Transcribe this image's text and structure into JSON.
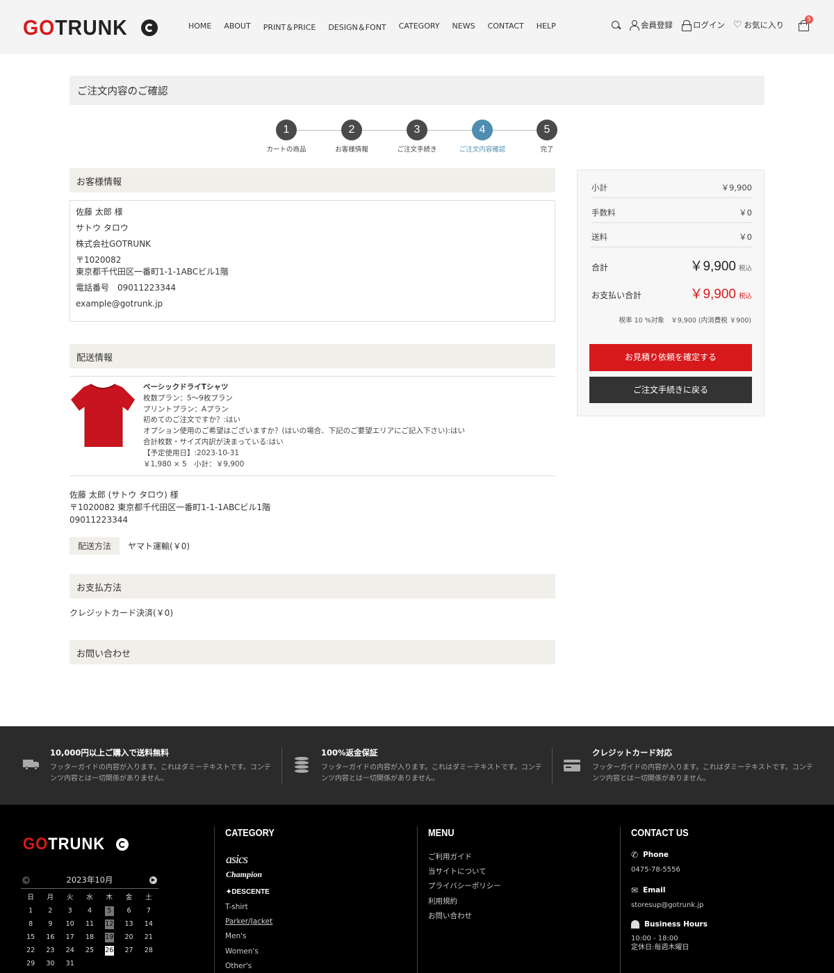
{
  "header": {
    "logo_go": "GO",
    "logo_trunk": "TRUNK",
    "nav": [
      "HOME",
      "ABOUT",
      "PRINT＆PRICE",
      "DESIGN＆FONT",
      "CATEGORY",
      "NEWS",
      "CONTACT",
      "HELP"
    ],
    "register": "会員登録",
    "login": "ログイン",
    "favorites": "お気に入り",
    "cart_count": "5"
  },
  "page": {
    "title": "ご注文内容のご確認"
  },
  "steps": [
    {
      "num": "1",
      "label": "カートの商品"
    },
    {
      "num": "2",
      "label": "お客様情報"
    },
    {
      "num": "3",
      "label": "ご注文手続き"
    },
    {
      "num": "4",
      "label": "ご注文内容確認"
    },
    {
      "num": "5",
      "label": "完了"
    }
  ],
  "customer": {
    "heading": "お客様情報",
    "name": "佐藤 太郎 様",
    "kana": "サトウ タロウ",
    "company": "株式会社GOTRUNK",
    "zip": "〒1020082",
    "address": "東京都千代田区一番町1-1-1ABCビル1階",
    "phone": "電話番号　09011223344",
    "email": "example@gotrunk.jp"
  },
  "shipping": {
    "heading": "配送情報",
    "product_name": "ベーシックドライTシャツ",
    "product_lines": [
      "枚数プラン：5〜9枚プラン",
      "プリントプラン：Aプラン",
      "初めてのご注文ですか？:はい",
      "オプション使用のご希望はございますか？(はいの場合、下記のご要望エリアにご記入下さい):はい",
      "合計枚数・サイズ内訳が決まっている:はい",
      "【予定使用日】:2023-10-31",
      "￥1,980 × 5　小計：￥9,900"
    ],
    "recipient": "佐藤 太郎 (サトウ タロウ) 様",
    "recipient_address": "〒1020082 東京都千代田区一番町1-1-1ABCビル1階",
    "recipient_phone": "09011223344",
    "method_label": "配送方法",
    "method_value": "ヤマト運輸(￥0)"
  },
  "payment": {
    "heading": "お支払方法",
    "value": "クレジットカード決済(￥0)"
  },
  "inquiry": {
    "heading": "お問い合わせ"
  },
  "summary": {
    "subtotal_label": "小計",
    "subtotal": "￥9,900",
    "fee_label": "手数料",
    "fee": "￥0",
    "shipping_label": "送料",
    "shipping": "￥0",
    "total_label": "合計",
    "total": "￥9,900",
    "pay_total_label": "お支払い合計",
    "pay_total": "￥9,900",
    "tax_incl": "税込",
    "tax_note": "税率 10 %対象　￥9,900 (内消費税 ￥900)",
    "confirm_button": "お見積り依頼を確定する",
    "back_button": "ご注文手続きに戻る"
  },
  "guide": [
    {
      "title": "10,000円以上ご購入で送料無料",
      "desc": "フッターガイドの内容が入ります。これはダミーテキストです。コンテンツ内容とは一切関係がありません。",
      "icon": "truck-icon"
    },
    {
      "title": "100%返金保証",
      "desc": "フッターガイドの内容が入ります。これはダミーテキストです。コンテンツ内容とは一切関係がありません。",
      "icon": "coins-icon"
    },
    {
      "title": "クレジットカード対応",
      "desc": "フッターガイドの内容が入ります。これはダミーテキストです。コンテンツ内容とは一切関係がありません。",
      "icon": "credit-card-icon"
    }
  ],
  "footer": {
    "calendar_title": "2023年10月",
    "weekdays": [
      "日",
      "月",
      "火",
      "水",
      "木",
      "金",
      "土"
    ],
    "days": [
      "1",
      "2",
      "3",
      "4",
      "5",
      "6",
      "7",
      "8",
      "9",
      "10",
      "11",
      "12",
      "13",
      "14",
      "15",
      "16",
      "17",
      "18",
      "19",
      "20",
      "21",
      "22",
      "23",
      "24",
      "25",
      "26",
      "27",
      "28",
      "29",
      "30",
      "31"
    ],
    "highlighted_days": [
      "5",
      "12",
      "19"
    ],
    "today": "26",
    "category_title": "CATEGORY",
    "brands": [
      "asics",
      "Champion",
      "DESCENTE"
    ],
    "categories": [
      "T-shirt",
      "Parker/Jacket",
      "Men's",
      "Women's",
      "Other's"
    ],
    "menu_title": "MENU",
    "menu": [
      "ご利用ガイド",
      "当サイトについて",
      "プライバシーポリシー",
      "利用規約",
      "お問い合わせ"
    ],
    "contact_title": "CONTACT US",
    "phone_label": "Phone",
    "phone": "0475-78-5556",
    "email_label": "Email",
    "email": "storesup@gotrunk.jp",
    "hours_label": "Business Hours",
    "hours": "10:00 - 18:00",
    "holiday": "定休日:毎週木曜日"
  }
}
